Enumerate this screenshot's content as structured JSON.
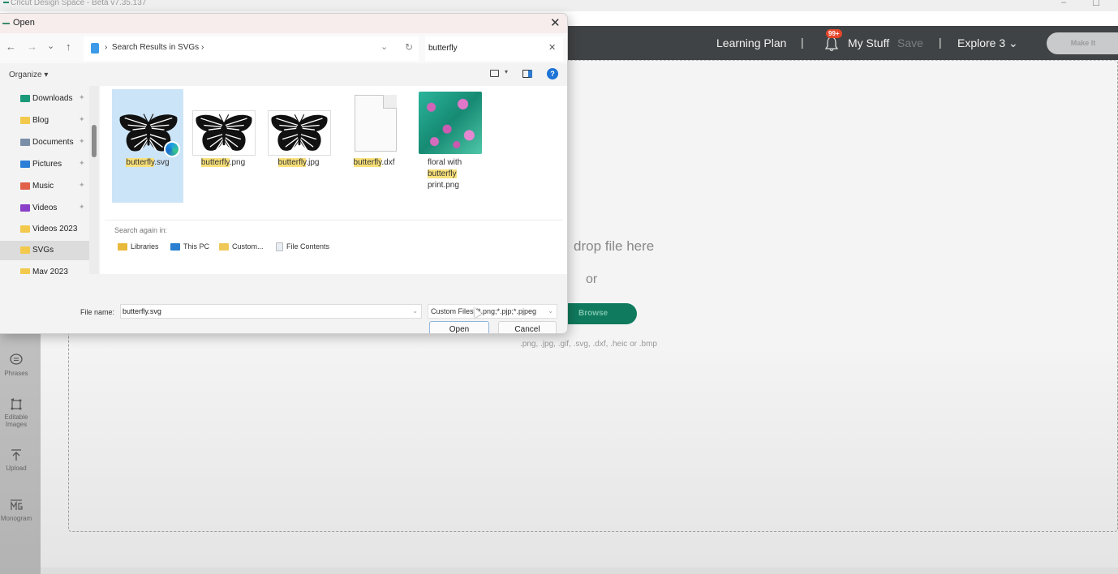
{
  "app": {
    "title": "Cricut Design Space - Beta v7.35.137",
    "window_controls": {
      "minimize": "–",
      "maximize": "☐"
    }
  },
  "header": {
    "learning_plan": "Learning Plan",
    "separator": "|",
    "notification_badge": "99+",
    "my_stuff": "My Stuff",
    "save": "Save",
    "explore": "Explore 3",
    "explore_chevron": "⌄",
    "make_it": "Make It"
  },
  "tool_sidebar": {
    "items": [
      {
        "label": "Phrases",
        "icon": "speech-bubble-icon",
        "glyph": "💬"
      },
      {
        "label": "Editable Images",
        "icon": "editable-image-icon",
        "glyph": "⌗"
      },
      {
        "label": "Upload",
        "icon": "upload-icon",
        "glyph": "⤒"
      },
      {
        "label": "Monogram",
        "icon": "monogram-icon",
        "glyph": "ℳ"
      }
    ]
  },
  "upload_area": {
    "drop_text": "drop file here",
    "or_text": "or",
    "browse_label": "Browse",
    "formats": ".png, .jpg, .gif, .svg, .dxf, .heic or .bmp",
    "accent_color": "#0f7a5d"
  },
  "dialog": {
    "title": "Open",
    "close": "✕",
    "nav": {
      "back": "←",
      "forward": "→",
      "recent": "⌄",
      "up": "↑"
    },
    "address": {
      "crumb": "Search Results in SVGs",
      "chev_before": "›",
      "chev_after": "›",
      "dropdown": "⌄",
      "refresh": "↻"
    },
    "search": {
      "value": "butterfly",
      "clear": "✕"
    },
    "organize": "Organize ▾",
    "view_dropdown": "▾",
    "help": "?",
    "nav_pane": [
      {
        "label": "Downloads",
        "icon": "downloads-folder-icon",
        "color": "#1a9a7a",
        "pinned": true
      },
      {
        "label": "Blog",
        "icon": "folder-icon",
        "color": "#f2c94c",
        "pinned": true
      },
      {
        "label": "Documents",
        "icon": "documents-folder-icon",
        "color": "#7a8ea8",
        "pinned": true
      },
      {
        "label": "Pictures",
        "icon": "pictures-folder-icon",
        "color": "#2b7fd6",
        "pinned": true
      },
      {
        "label": "Music",
        "icon": "music-folder-icon",
        "color": "#e0604a",
        "pinned": true
      },
      {
        "label": "Videos",
        "icon": "videos-folder-icon",
        "color": "#8a3fc8",
        "pinned": true
      },
      {
        "label": "Videos 2023",
        "icon": "folder-icon",
        "color": "#f2c94c",
        "pinned": false
      },
      {
        "label": "SVGs",
        "icon": "folder-icon",
        "color": "#f2c94c",
        "pinned": false,
        "selected": true
      },
      {
        "label": "May 2023",
        "icon": "folder-icon",
        "color": "#f2c94c",
        "pinned": false
      }
    ],
    "pin_glyph": "📌",
    "files": [
      {
        "match": "butterfly",
        "rest": ".svg",
        "selected": true
      },
      {
        "match": "butterfly",
        "rest": ".png"
      },
      {
        "match": "butterfly",
        "rest": ".jpg"
      },
      {
        "match": "butterfly",
        "rest": ".dxf"
      },
      {
        "before": "floral with",
        "match": "butterfly",
        "rest": "print.png"
      }
    ],
    "search_again": {
      "label": "Search again in:",
      "options": [
        "Libraries",
        "This PC",
        "Custom...",
        "File Contents"
      ]
    },
    "file_name_label": "File name:",
    "file_name_value": "butterfly.svg",
    "file_type": "Custom Files (*.png;*.pjp;*.pjpeg",
    "open_label": "Open",
    "cancel_label": "Cancel"
  }
}
